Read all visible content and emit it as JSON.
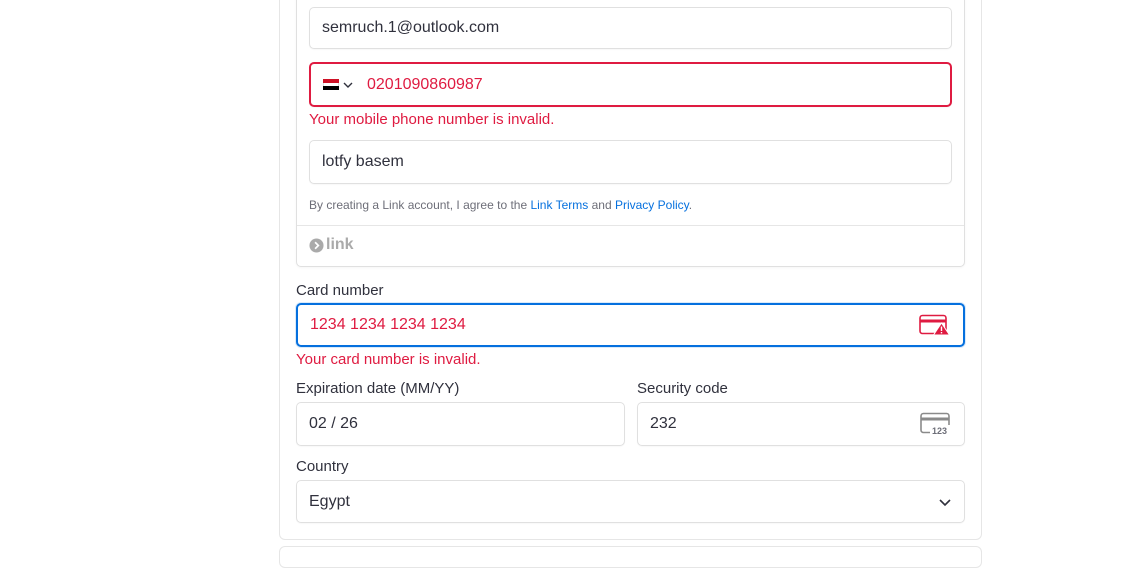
{
  "link_section": {
    "email_value": "semruch.1@outlook.com",
    "phone_country_flag": "egypt-flag-icon",
    "phone_value": "0201090860987",
    "phone_error": "Your mobile phone number is invalid.",
    "name_value": "lotfy basem",
    "terms_prefix": "By creating a Link account, I agree to the ",
    "terms_link": "Link Terms",
    "terms_and": " and ",
    "privacy_link": "Privacy Policy",
    "terms_suffix": ".",
    "brand": "link"
  },
  "card": {
    "label": "Card number",
    "value": "1234 1234 1234 1234",
    "error": "Your card number is invalid.",
    "icon": "card-error-icon"
  },
  "expiry": {
    "label": "Expiration date (MM/YY)",
    "value": "02 / 26"
  },
  "security": {
    "label": "Security code",
    "value": "232",
    "icon": "cvc-card-icon",
    "icon_text": "123"
  },
  "country": {
    "label": "Country",
    "value": "Egypt"
  },
  "colors": {
    "error": "#df1b41",
    "focus": "#0570de",
    "link": "#0570de"
  }
}
